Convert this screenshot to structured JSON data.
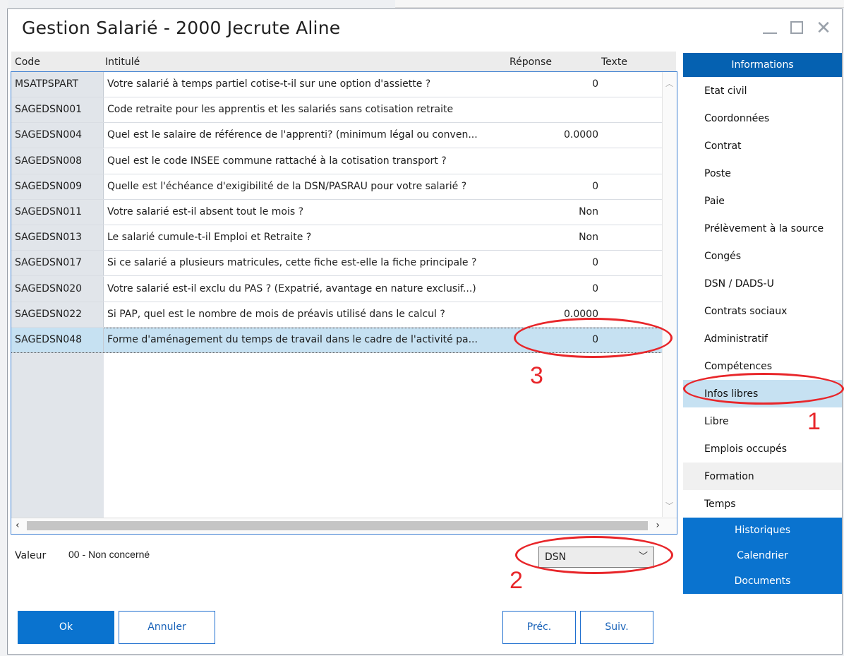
{
  "window": {
    "title": "Gestion Salarié - 2000 Jecrute Aline"
  },
  "grid": {
    "headers": {
      "code": "Code",
      "intitule": "Intitulé",
      "reponse": "Réponse",
      "texte": "Texte"
    },
    "rows": [
      {
        "code": "MSATPSPART",
        "label": "Votre salarié à temps partiel cotise-t-il sur une option d'assiette ?",
        "reponse": "0"
      },
      {
        "code": "SAGEDSN001",
        "label": "Code retraite pour les apprentis et les salariés sans cotisation retraite",
        "reponse": ""
      },
      {
        "code": "SAGEDSN004",
        "label": "Quel est le salaire de référence de l'apprenti? (minimum légal ou conven...",
        "reponse": "0.0000"
      },
      {
        "code": "SAGEDSN008",
        "label": "Quel est le code INSEE commune rattaché à la cotisation transport ?",
        "reponse": ""
      },
      {
        "code": "SAGEDSN009",
        "label": "Quelle est l'échéance d'exigibilité de la DSN/PASRAU pour votre salarié ?",
        "reponse": "0"
      },
      {
        "code": "SAGEDSN011",
        "label": "Votre salarié est-il absent tout le mois ?",
        "reponse": "Non"
      },
      {
        "code": "SAGEDSN013",
        "label": "Le salarié cumule-t-il Emploi et Retraite ?",
        "reponse": "Non"
      },
      {
        "code": "SAGEDSN017",
        "label": "Si ce salarié a plusieurs matricules, cette fiche est-elle la fiche principale ?",
        "reponse": "0"
      },
      {
        "code": "SAGEDSN020",
        "label": "Votre salarié est-il exclu du PAS ? (Expatrié, avantage en nature exclusif...)",
        "reponse": "0"
      },
      {
        "code": "SAGEDSN022",
        "label": "Si PAP, quel est le nombre de mois de préavis utilisé dans le calcul ?",
        "reponse": "0.0000"
      },
      {
        "code": "SAGEDSN048",
        "label": "Forme d'aménagement du temps de travail dans le cadre de l'activité pa...",
        "reponse": "0",
        "selected": true
      }
    ]
  },
  "valeur": {
    "label": "Valeur",
    "value": "00 - Non concerné"
  },
  "filter": {
    "selected": "DSN"
  },
  "buttons": {
    "ok": "Ok",
    "annuler": "Annuler",
    "prec": "Préc.",
    "suiv": "Suiv."
  },
  "sidebar": {
    "header": "Informations",
    "items": [
      "Etat civil",
      "Coordonnées",
      "Contrat",
      "Poste",
      "Paie",
      "Prélèvement à la source",
      "Congés",
      "DSN / DADS-U",
      "Contrats sociaux",
      "Administratif",
      "Compétences",
      "Infos libres",
      "Libre",
      "Emplois occupés",
      "Formation",
      "Temps"
    ],
    "active": "Infos libres",
    "bottom": [
      "Historiques",
      "Calendrier",
      "Documents"
    ]
  },
  "annotations": [
    "1",
    "2",
    "3"
  ],
  "colors": {
    "accent": "#0a73cf",
    "header_blue": "#0561b1",
    "selection": "#c6e1f2",
    "annotation": "#e8262a"
  }
}
